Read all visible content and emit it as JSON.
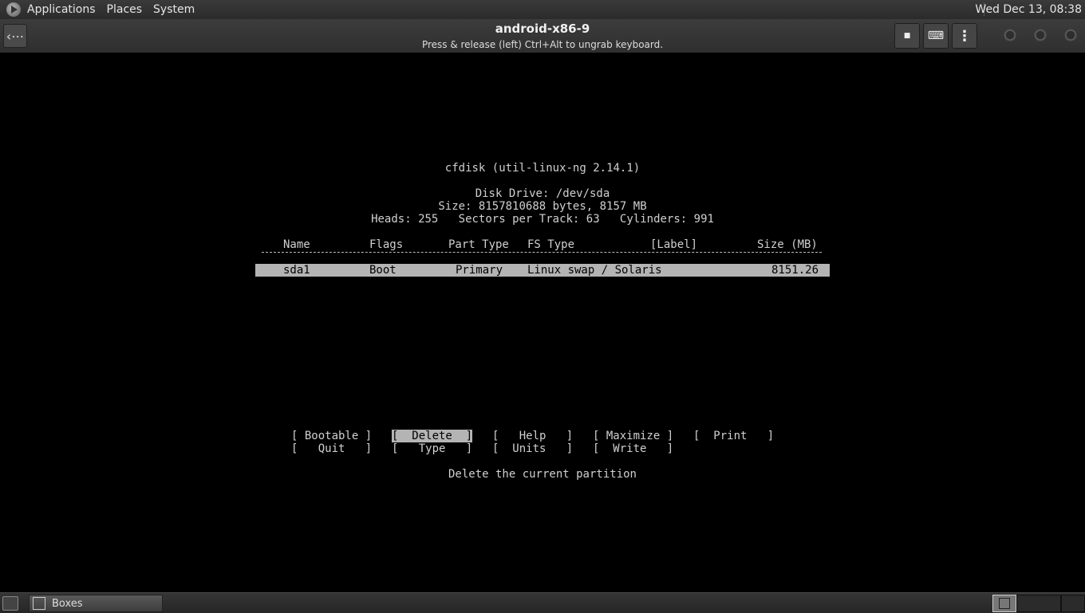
{
  "top_panel": {
    "menus": [
      "Applications",
      "Places",
      "System"
    ],
    "clock": "Wed Dec 13, 08:38"
  },
  "header": {
    "title": "android-x86-9",
    "subtitle": "Press & release (left) Ctrl+Alt to ungrab keyboard.",
    "buttons": {
      "stop": "■",
      "keyboard": "⌨",
      "menu": "⋮"
    }
  },
  "terminal": {
    "app_title": "cfdisk (util-linux-ng 2.14.1)",
    "disk_drive": "Disk Drive: /dev/sda",
    "size_line": "Size: 8157810688 bytes, 8157 MB",
    "geometry_line": "Heads: 255   Sectors per Track: 63   Cylinders: 991",
    "columns": {
      "name": "Name",
      "flags": "Flags",
      "part_type": "Part Type",
      "fs_type": "FS Type",
      "label": "[Label]",
      "size": "Size (MB)"
    },
    "partitions": [
      {
        "name": "sda1",
        "flags": "Boot",
        "part_type": "Primary",
        "fs_type": "Linux swap / Solaris",
        "size": "8151.26"
      }
    ],
    "menu": {
      "bootable": "[ Bootable ]",
      "delete": "[  Delete  ]",
      "help": "[   Help   ]",
      "maximize": "[ Maximize ]",
      "print": "[  Print   ]",
      "quit": "[   Quit   ]",
      "type": "[   Type   ]",
      "units": "[  Units   ]",
      "write": "[  Write   ]",
      "selected": "delete"
    },
    "help_text": "Delete the current partition"
  },
  "bottom_panel": {
    "task_label": "Boxes"
  }
}
